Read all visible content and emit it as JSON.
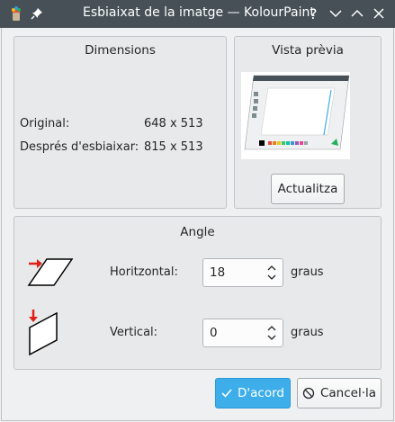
{
  "window": {
    "title": "Esbiaixat de la imatge — KolourPaint",
    "colors": {
      "titlebar": "#475057",
      "accent": "#3daee9"
    }
  },
  "dimensions": {
    "title": "Dimensions",
    "original_label": "Original:",
    "original_value": "648 x 513",
    "after_label": "Després d'esbiaixar:",
    "after_value": "815 x 513"
  },
  "preview": {
    "title": "Vista prèvia",
    "update_button": "Actualitza"
  },
  "angle": {
    "title": "Angle",
    "horizontal_label": "Horitzontal:",
    "horizontal_value": "18",
    "horizontal_unit": "graus",
    "vertical_label": "Vertical:",
    "vertical_value": "0",
    "vertical_unit": "graus"
  },
  "buttons": {
    "ok": "D'acord",
    "cancel": "Cancel·la"
  },
  "icons": [
    "kolourpaint-app-icon",
    "pin-icon",
    "help-icon",
    "minimize-icon",
    "maximize-icon",
    "close-icon",
    "check-icon",
    "cancel-icon"
  ]
}
